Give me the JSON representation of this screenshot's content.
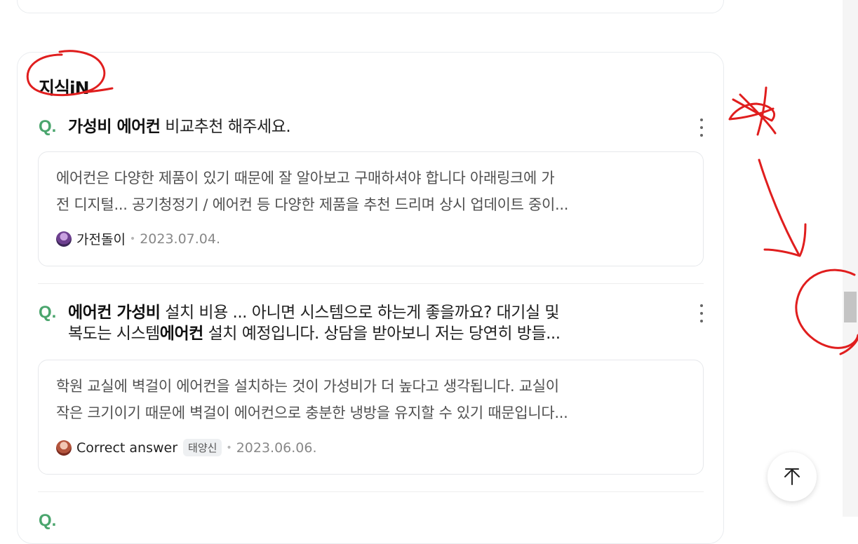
{
  "section": {
    "title": "지식iN"
  },
  "questions": [
    {
      "q_mark": "Q.",
      "title_parts": [
        {
          "text": "가성비 에어컨",
          "bold": true
        },
        {
          "text": " 비교추천 해주세요.",
          "bold": false
        }
      ],
      "answer_lines": [
        "에어컨은 다양한 제품이 있기 때문에 잘 알아보고 구매하셔야 합니다 아래링크에 가",
        "전 디지털... 공기청정기 / 에어컨 등 다양한 제품을 추천 드리며 상시 업데이트 중이..."
      ],
      "author": "가전돌이",
      "date": "2023.07.04."
    },
    {
      "q_mark": "Q.",
      "title_line1_parts": [
        {
          "text": "에어컨 가성비",
          "bold": true
        },
        {
          "text": " 설치 비용 ... 아니면 시스템으로 하는게 좋을까요? 대기실 및",
          "bold": false
        }
      ],
      "title_line2_parts": [
        {
          "text": "복도는 시스템",
          "bold": false
        },
        {
          "text": "에어컨",
          "bold": true
        },
        {
          "text": " 설치 예정입니다. 상담을 받아보니 저는 당연히 방들...",
          "bold": false
        }
      ],
      "answer_lines": [
        "학원 교실에 벽걸이 에어컨을 설치하는 것이 가성비가 더 높다고 생각됩니다. 교실이",
        "작은 크기이기 때문에 벽걸이 에어컨으로 충분한 냉방을 유지할 수 있기 때문입니다..."
      ],
      "author": "Correct answer",
      "badge": "태양신",
      "date": "2023.06.06."
    }
  ],
  "meta_separator": "•",
  "icons": {
    "more": "more-vertical-icon",
    "top": "arrow-up-icon",
    "avatar": "user-avatar-icon"
  },
  "colors": {
    "q_mark": "#4aa56d",
    "annotation": "#e01e1e"
  }
}
